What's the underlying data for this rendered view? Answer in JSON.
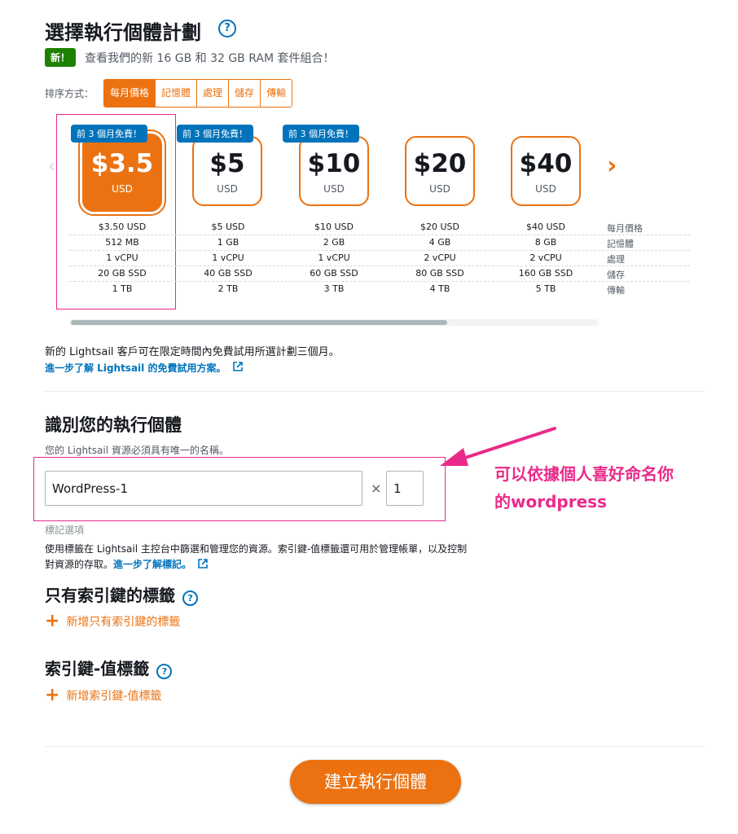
{
  "header": {
    "title": "選擇執行個體計劃",
    "help_icon": "?",
    "new_badge": "新！",
    "new_text": "查看我們的新 16 GB 和 32 GB RAM 套件組合！"
  },
  "sort": {
    "label": "排序方式：",
    "options": [
      "每月價格",
      "記憶體",
      "處理",
      "儲存",
      "傳輸"
    ],
    "selected": "每月價格"
  },
  "plans": [
    {
      "price": "$3.5",
      "currency": "USD",
      "promo": "前 3 個月免費！",
      "monthly": "$3.50 USD",
      "memory": "512 MB",
      "cpu": "1 vCPU",
      "storage": "20 GB SSD",
      "transfer": "1 TB",
      "selected": true
    },
    {
      "price": "$5",
      "currency": "USD",
      "promo": "前 3 個月免費！",
      "monthly": "$5 USD",
      "memory": "1 GB",
      "cpu": "1 vCPU",
      "storage": "40 GB SSD",
      "transfer": "2 TB",
      "selected": false
    },
    {
      "price": "$10",
      "currency": "USD",
      "promo": "前 3 個月免費！",
      "monthly": "$10 USD",
      "memory": "2 GB",
      "cpu": "1 vCPU",
      "storage": "60 GB SSD",
      "transfer": "3 TB",
      "selected": false
    },
    {
      "price": "$20",
      "currency": "USD",
      "promo": "",
      "monthly": "$20 USD",
      "memory": "4 GB",
      "cpu": "2 vCPU",
      "storage": "80 GB SSD",
      "transfer": "4 TB",
      "selected": false
    },
    {
      "price": "$40",
      "currency": "USD",
      "promo": "",
      "monthly": "$40 USD",
      "memory": "8 GB",
      "cpu": "2 vCPU",
      "storage": "160 GB SSD",
      "transfer": "5 TB",
      "selected": false
    }
  ],
  "spec_labels": [
    "每月價格",
    "記憶體",
    "處理",
    "儲存",
    "傳輸"
  ],
  "trial": {
    "text": "新的 Lightsail 客戶可在限定時間內免費試用所選計劃三個月。",
    "link": "進一步了解 Lightsail 的免費試用方案。"
  },
  "identify": {
    "title": "識別您的執行個體",
    "subtitle": "您的 Lightsail 資源必須具有唯一的名稱。",
    "name_value": "WordPress-1",
    "times": "×",
    "count_value": "1"
  },
  "tags": {
    "options_label": "標記選項",
    "description_line1": "使用標籤在 Lightsail 主控台中篩選和管理您的資源。索引鍵-值標籤還可用於管理帳單，以及控制",
    "description_line2": "對資源的存取。",
    "learn_more": "進一步了解標記。",
    "key_only_title": "只有索引鍵的標籤",
    "add_key_only": "新增只有索引鍵的標籤",
    "key_value_title": "索引鍵-值標籤",
    "add_key_value": "新增索引鍵-值標籤"
  },
  "create_button": "建立執行個體",
  "annotation": {
    "line1": "可以依據個人喜好命名你",
    "line2": "的wordpress"
  },
  "colors": {
    "accent": "#ec7211",
    "link": "#0073bb",
    "new_badge": "#1d8102",
    "annotation": "#ea2a8a"
  },
  "icons": [
    "help-icon",
    "chevron-left-icon",
    "chevron-right-icon",
    "external-link-icon",
    "plus-icon",
    "arrow-icon"
  ]
}
